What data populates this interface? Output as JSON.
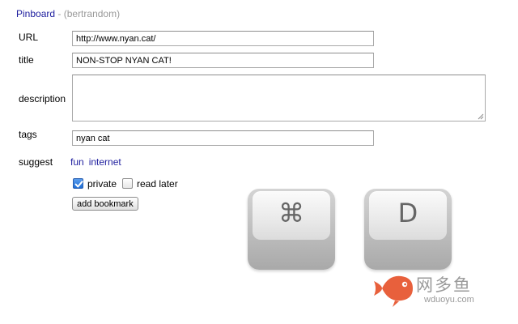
{
  "header": {
    "brand": "Pinboard",
    "separator": " - ",
    "user": "(bertrandom)"
  },
  "form": {
    "url_label": "URL",
    "url_value": "http://www.nyan.cat/",
    "title_label": "title",
    "title_value": "NON-STOP NYAN CAT!",
    "description_label": "description",
    "description_value": "",
    "tags_label": "tags",
    "tags_value": "nyan cat",
    "suggest_label": "suggest",
    "suggested_tags": [
      "fun",
      "internet"
    ],
    "private_label": "private",
    "private_checked": true,
    "read_later_label": "read later",
    "read_later_checked": false,
    "submit_label": "add bookmark"
  },
  "shortcut": {
    "command_key": "⌘",
    "letter_key": "D",
    "icon": "command-key-icon"
  },
  "watermark": {
    "name": "网多鱼",
    "domain": "wduoyu.com",
    "icon": "fish-logo-icon",
    "color": "#e8603c"
  }
}
